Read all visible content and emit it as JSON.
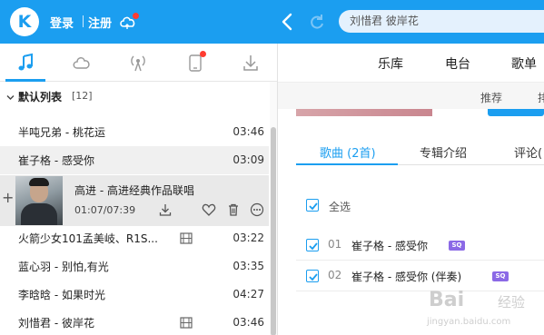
{
  "topbar": {
    "logo_letter": "K",
    "login_label": "登录",
    "register_label": "注册",
    "search_value": "刘惜君 彼岸花",
    "accent": "#1b9ef0"
  },
  "left_tabs": [
    {
      "name": "music-note-icon",
      "active": true
    },
    {
      "name": "cloud-icon"
    },
    {
      "name": "radio-icon"
    },
    {
      "name": "device-icon",
      "badge": true
    },
    {
      "name": "download-icon"
    }
  ],
  "playlist": {
    "title": "默认列表",
    "count": "[12]"
  },
  "songs": [
    {
      "name": "半吨兄弟 - 桃花运",
      "duration": "03:46"
    },
    {
      "name": "崔子格 - 感受你",
      "duration": "03:09"
    },
    {
      "name": "火箭少女101孟美岐、R1S...",
      "duration": "03:22",
      "mv": true
    },
    {
      "name": "蓝心羽 - 别怕,有光",
      "duration": "03:35"
    },
    {
      "name": "李晗晗 - 如果时光",
      "duration": "04:27"
    },
    {
      "name": "刘惜君 - 彼岸花",
      "duration": "03:46",
      "mv": true
    }
  ],
  "now_playing": {
    "title": "高进 - 高进经典作品联唱",
    "time": "01:07/07:39"
  },
  "main_nav": [
    "乐库",
    "电台",
    "歌单"
  ],
  "sub_nav": [
    "推荐",
    "排"
  ],
  "content_tabs": [
    "歌曲 (2首)",
    "专辑介绍",
    "评论("
  ],
  "select_all_label": "全选",
  "track_rows": [
    {
      "num": "01",
      "name": "崔子格 - 感受你",
      "badge": "SQ"
    },
    {
      "num": "02",
      "name": "崔子格 - 感受你 (伴奏)",
      "badge": "SQ"
    }
  ],
  "watermark": {
    "line1": "Bai",
    "line1b": "经验",
    "line2": "jingyan.baidu.com"
  }
}
